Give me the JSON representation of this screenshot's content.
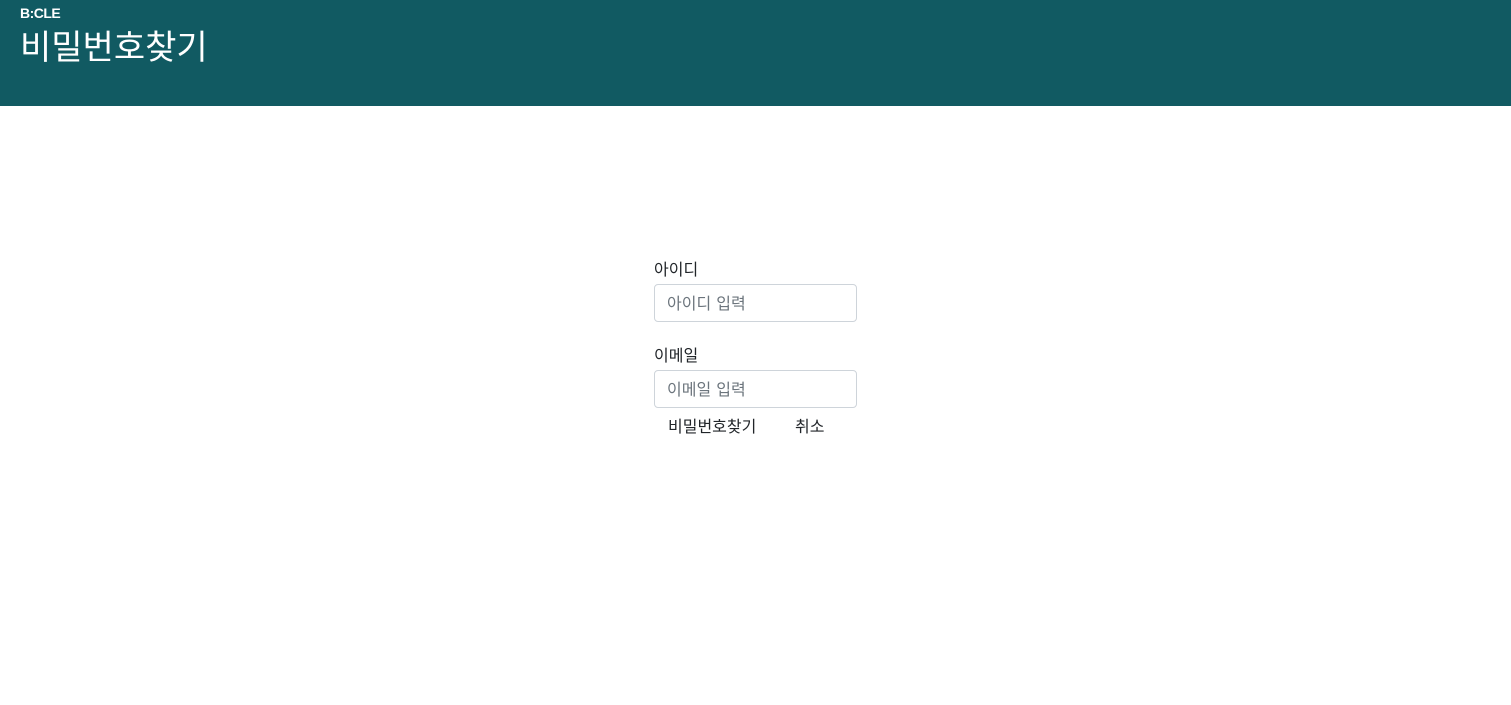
{
  "header": {
    "brand": "B:CLE",
    "title": "비밀번호찾기",
    "background_color": "#115a62"
  },
  "form": {
    "id_label": "아이디",
    "id_placeholder": "아이디 입력",
    "email_label": "이메일",
    "email_placeholder": "이메일 입력",
    "submit_label": "비밀번호찾기",
    "cancel_label": "취소"
  }
}
